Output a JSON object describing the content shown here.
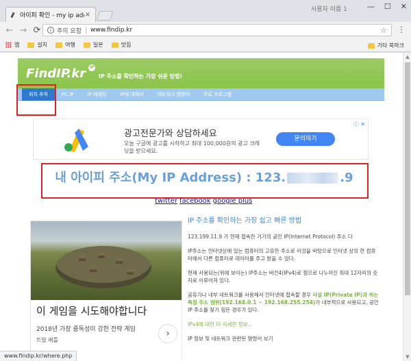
{
  "browser": {
    "tab_title": "아이피 확인 - my ip add",
    "tab_close": "×",
    "profile_name": "사용자 이름 1",
    "window_controls": {
      "minimize": "—",
      "maximize": "☐",
      "close": "✕"
    },
    "nav": {
      "back": "←",
      "forward": "→",
      "reload": "⟳"
    },
    "omnibox": {
      "security_label": "주의 요함",
      "url": "www.findip.kr"
    },
    "bookmarks": [
      {
        "label": "앱",
        "icon": "apps-icon"
      },
      {
        "label": "설치",
        "icon": "folder-icon"
      },
      {
        "label": "여행",
        "icon": "folder-icon"
      },
      {
        "label": "일본",
        "icon": "folder-icon"
      },
      {
        "label": "맛집",
        "icon": "folder-icon"
      }
    ],
    "other_bookmarks": "기타 북마크",
    "status_url": "www.findip.kr/where.php"
  },
  "site": {
    "logo": "FindIP.kr",
    "logo_badge": "IP",
    "tagline": "IP 주소를 확인하는 가장 쉬운 방법!",
    "nav": [
      "위치 추적",
      "PC IP",
      "IP 메세징",
      "IP에 대해서",
      "네트워크 명령어",
      "무료 프로그램"
    ]
  },
  "ad_top": {
    "title": "광고전문가와 상담하세요",
    "desc": "오늘 구글에 광고를 시작하고 최대 100,000원의 광고 크레딧을 받으세요.",
    "cta": "문의하기",
    "info": "ⓘ ✕"
  },
  "ip": {
    "label_prefix": "내 아이피 주소(My IP Address) : 123.",
    "label_suffix": ".9"
  },
  "share": [
    "twitter",
    "facebook",
    "google plus"
  ],
  "ad_game": {
    "title": "이 게임을 시도해야합니다",
    "subtitle": "2018년 가장 중독성이 강한 전략 게임",
    "tag": "트랄 배틀",
    "arrow": "›"
  },
  "article": {
    "heading": "IP 주소를 확인하는 가장 쉽고 빠른 방법",
    "p1": "123.199.11.9 가 현재 접속한 기기의 공인 IP(Internet Protocol) 주소 다",
    "p2": "IP주소는 인터넷상에 있는 컴퓨터의 고유한 주소로 이것을 바탕으로 인터넷 상의 한 컴퓨터에서 다른 컴퓨터로 데이터를 주고 받을 수 있다.",
    "p3": "현재 사용되는(위에 보이는) IP주소는 버전4(IPv4)로 점으로 나누어진 최대 12자리의 숫자로 이루어져 있다.",
    "p4_a": "공유기나 내부 네트워크를 사용해서 인터넷에 접속할 경우 ",
    "p4_green": "사설 IP(Private IP)과 하는 특정 주소 범위(192.168.0.1 ~ 192.168.255.254)",
    "p4_b": "가 내부적으로 사용되고, 공인 IP 주소를 찾기 힘든 경우가 있다.",
    "link1": "IPv4에 대한 더 자세한 정보...",
    "link2": "IP 정보 및 네트워크 관련된 명령어 보기"
  }
}
